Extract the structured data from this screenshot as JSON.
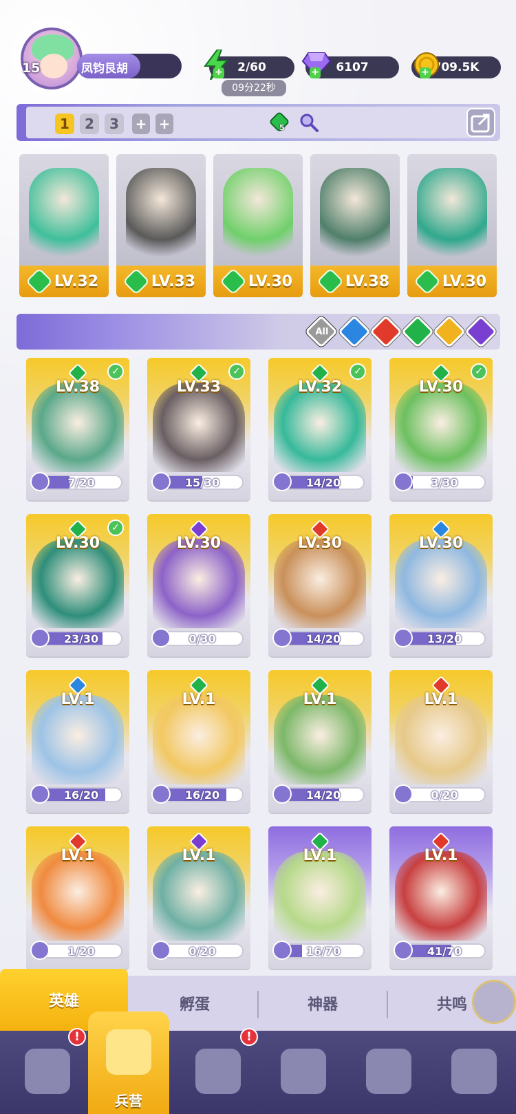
{
  "player": {
    "level": "15",
    "name": "凤钧艮胡"
  },
  "resources": {
    "energy": "2/60",
    "energy_timer": "09分22秒",
    "gems": "6107",
    "gold": "709.5K"
  },
  "team": {
    "tabs": [
      "1",
      "2",
      "3"
    ],
    "active_tab": "1",
    "gem_count": "5"
  },
  "lineup": [
    {
      "level": "LV.32",
      "art_color": "#3fbf9a"
    },
    {
      "level": "LV.33",
      "art_color": "#5a5a5a"
    },
    {
      "level": "LV.30",
      "art_color": "#6fd06a"
    },
    {
      "level": "LV.38",
      "art_color": "#4f7f6a"
    },
    {
      "level": "LV.30",
      "art_color": "#2fa88c"
    }
  ],
  "filters": {
    "all_label": "All",
    "elements": [
      "water",
      "fire",
      "wind",
      "light",
      "dark"
    ]
  },
  "heroes": [
    {
      "level": "LV.38",
      "element": "wind",
      "shards": "7/20",
      "progress": 0.35,
      "check": true,
      "frame": "gold",
      "art": "#5aa88a"
    },
    {
      "level": "LV.33",
      "element": "wind",
      "shards": "15/30",
      "progress": 0.5,
      "check": true,
      "frame": "gold",
      "art": "#6a5f63"
    },
    {
      "level": "LV.32",
      "element": "wind",
      "shards": "14/20",
      "progress": 0.7,
      "check": true,
      "frame": "gold",
      "art": "#37b99a"
    },
    {
      "level": "LV.30",
      "element": "wind",
      "shards": "3/30",
      "progress": 0.1,
      "check": true,
      "frame": "gold",
      "art": "#6cc060"
    },
    {
      "level": "LV.30",
      "element": "wind",
      "shards": "23/30",
      "progress": 0.77,
      "check": true,
      "frame": "gold",
      "art": "#2e8e7a"
    },
    {
      "level": "LV.30",
      "element": "dark",
      "shards": "0/30",
      "progress": 0.0,
      "check": false,
      "frame": "gold",
      "art": "#8c62c8"
    },
    {
      "level": "LV.30",
      "element": "fire",
      "shards": "14/20",
      "progress": 0.7,
      "check": false,
      "frame": "gold",
      "art": "#c9905a"
    },
    {
      "level": "LV.30",
      "element": "water",
      "shards": "13/20",
      "progress": 0.65,
      "check": false,
      "frame": "gold",
      "art": "#8fb8e0"
    },
    {
      "level": "LV.1",
      "element": "water",
      "shards": "16/20",
      "progress": 0.8,
      "check": false,
      "frame": "gold",
      "art": "#9dc3e6"
    },
    {
      "level": "LV.1",
      "element": "wind",
      "shards": "16/20",
      "progress": 0.8,
      "check": false,
      "frame": "gold",
      "art": "#f2c862"
    },
    {
      "level": "LV.1",
      "element": "wind",
      "shards": "14/20",
      "progress": 0.7,
      "check": false,
      "frame": "gold",
      "art": "#7db86a"
    },
    {
      "level": "LV.1",
      "element": "fire",
      "shards": "0/20",
      "progress": 0.0,
      "check": false,
      "frame": "gold",
      "art": "#e6c98a"
    },
    {
      "level": "LV.1",
      "element": "fire",
      "shards": "1/20",
      "progress": 0.05,
      "check": false,
      "frame": "gold",
      "art": "#f08a40"
    },
    {
      "level": "LV.1",
      "element": "dark",
      "shards": "0/20",
      "progress": 0.0,
      "check": false,
      "frame": "gold",
      "art": "#6fb0a4"
    },
    {
      "level": "LV.1",
      "element": "wind",
      "shards": "16/70",
      "progress": 0.23,
      "check": false,
      "frame": "purple",
      "art": "#b6d98a"
    },
    {
      "level": "LV.1",
      "element": "fire",
      "shards": "41/70",
      "progress": 0.59,
      "check": false,
      "frame": "purple",
      "art": "#c84040"
    }
  ],
  "element_colors": {
    "wind": "#22b24a",
    "fire": "#e23a2a",
    "water": "#2a86e0",
    "light": "#f0b21e",
    "dark": "#7a3fd1"
  },
  "subtabs": [
    "英雄",
    "孵蛋",
    "神器",
    "共鸣"
  ],
  "nav": {
    "active_label": "兵营"
  }
}
